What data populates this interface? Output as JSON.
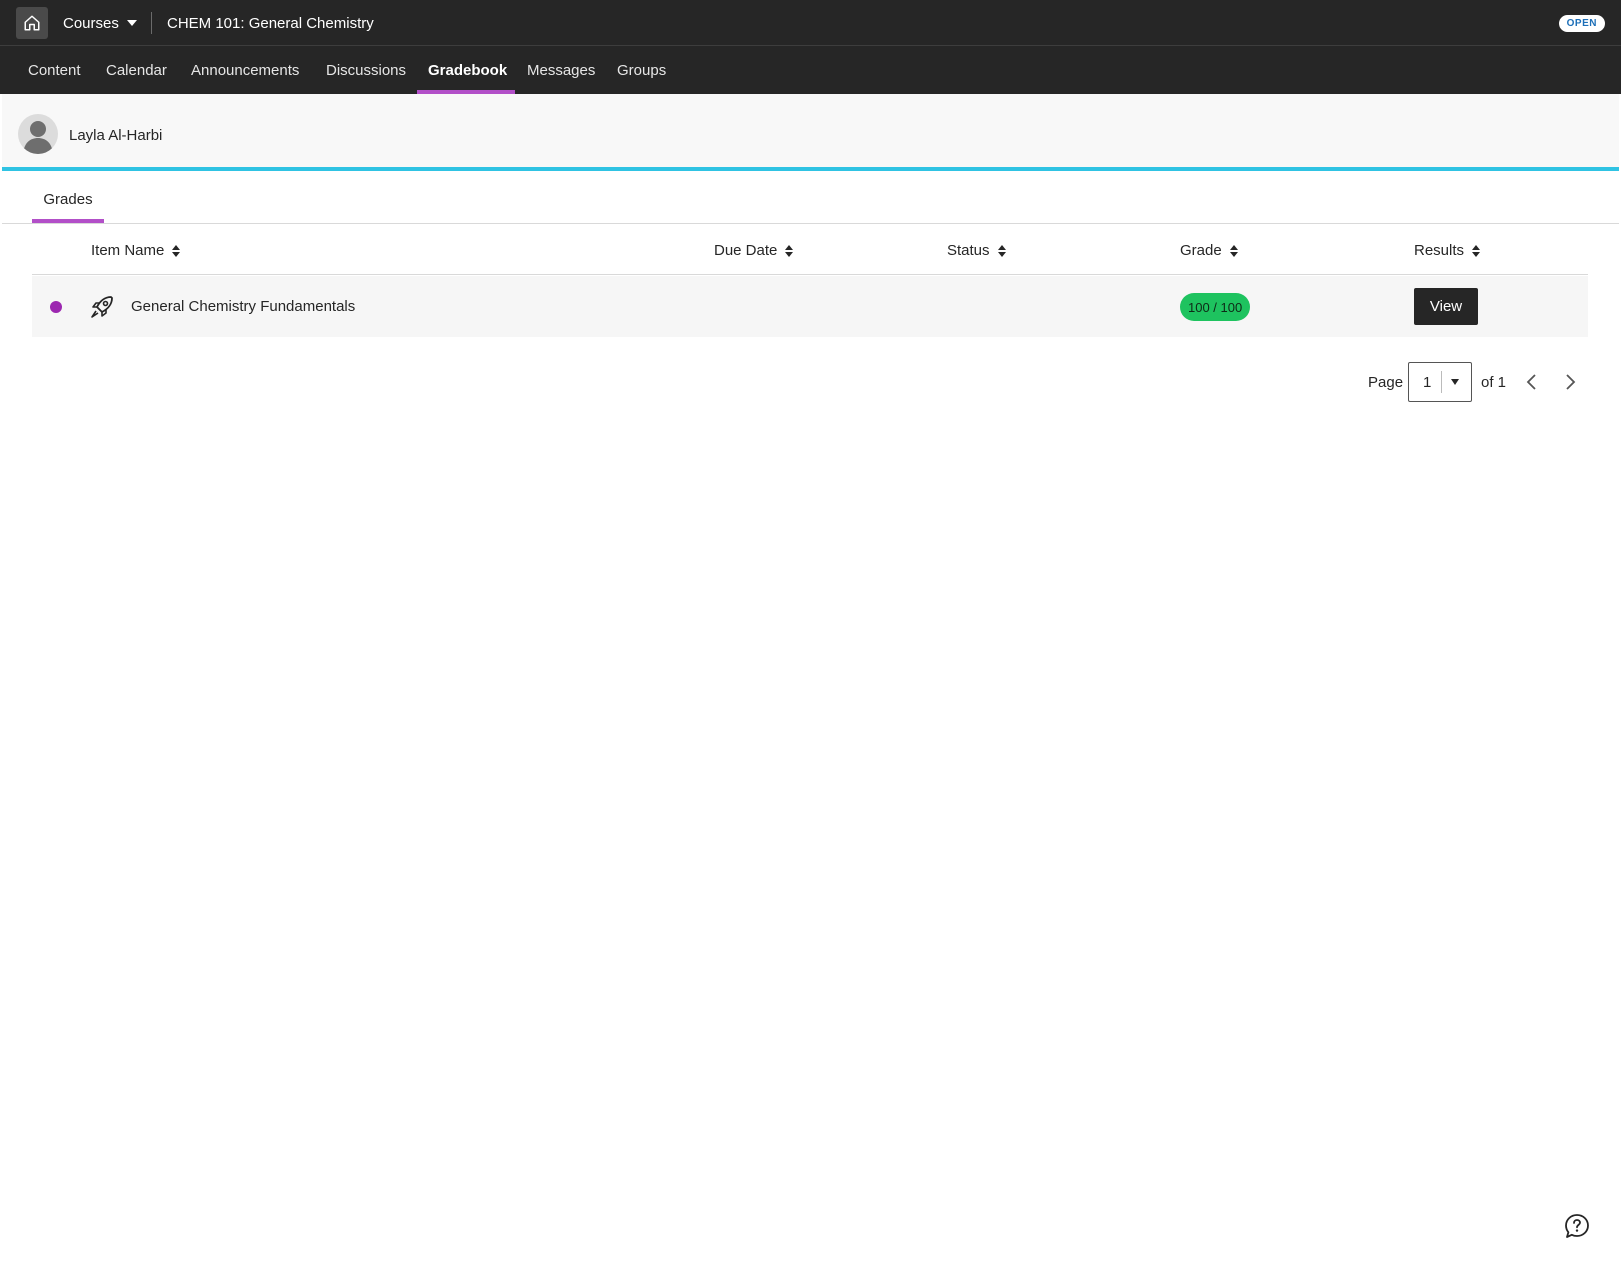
{
  "topbar": {
    "courses_label": "Courses",
    "course_title": "CHEM 101: General Chemistry",
    "badge": "OPEN"
  },
  "nav": {
    "items": [
      "Content",
      "Calendar",
      "Announcements",
      "Discussions",
      "Gradebook",
      "Messages",
      "Groups"
    ],
    "active": "Gradebook"
  },
  "student": {
    "name": "Layla Al-Harbi"
  },
  "tabs": {
    "grades": "Grades"
  },
  "table": {
    "headers": {
      "item_name": "Item Name",
      "due_date": "Due Date",
      "status": "Status",
      "grade": "Grade",
      "results": "Results"
    },
    "rows": [
      {
        "name": "General Chemistry Fundamentals",
        "due_date": "",
        "status": "",
        "grade": "100 / 100",
        "action": "View"
      }
    ]
  },
  "pagination": {
    "page_label": "Page",
    "current": "1",
    "of_label": "of 1"
  },
  "colors": {
    "accent": "#b24fc8",
    "stripe": "#2fc3e3",
    "grade_pill": "#1ec35f",
    "dark": "#262626"
  },
  "icons": [
    "home-icon",
    "avatar-icon",
    "sort-icon",
    "rocket-icon",
    "chevron-left-icon",
    "chevron-right-icon",
    "help-icon"
  ]
}
